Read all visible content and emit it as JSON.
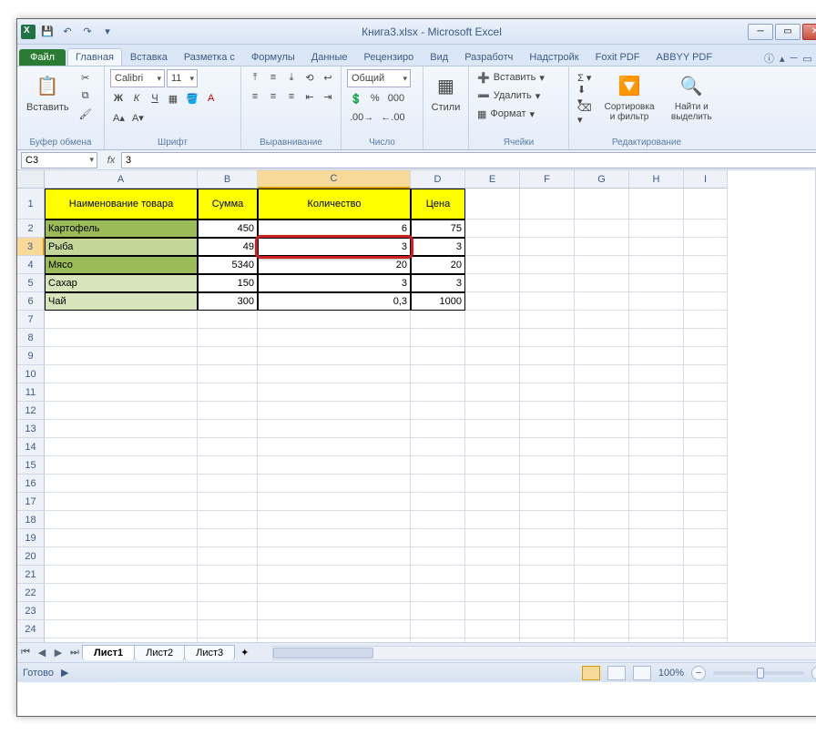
{
  "title": "Книга3.xlsx - Microsoft Excel",
  "qat": {
    "save": "💾",
    "undo": "↶",
    "redo": "↷"
  },
  "tabs": {
    "file": "Файл",
    "items": [
      "Главная",
      "Вставка",
      "Разметка с",
      "Формулы",
      "Данные",
      "Рецензиро",
      "Вид",
      "Разработч",
      "Надстройк",
      "Foxit PDF",
      "ABBYY PDF"
    ],
    "active": 0
  },
  "ribbon": {
    "clipboard": {
      "paste": "Вставить",
      "label": "Буфер обмена"
    },
    "font": {
      "name": "Calibri",
      "size": "11",
      "bold": "Ж",
      "italic": "К",
      "underline": "Ч",
      "label": "Шрифт"
    },
    "align": {
      "label": "Выравнивание"
    },
    "number": {
      "format": "Общий",
      "label": "Число"
    },
    "styles": {
      "btn": "Стили"
    },
    "cells": {
      "insert": "Вставить",
      "delete": "Удалить",
      "format": "Формат",
      "label": "Ячейки"
    },
    "editing": {
      "sort": "Сортировка и фильтр",
      "find": "Найти и выделить",
      "label": "Редактирование"
    }
  },
  "namebox": "C3",
  "formula": "3",
  "columns": [
    {
      "l": "A",
      "w": 168
    },
    {
      "l": "B",
      "w": 66
    },
    {
      "l": "C",
      "w": 168
    },
    {
      "l": "D",
      "w": 60
    },
    {
      "l": "E",
      "w": 60
    },
    {
      "l": "F",
      "w": 60
    },
    {
      "l": "G",
      "w": 60
    },
    {
      "l": "H",
      "w": 60
    },
    {
      "l": "I",
      "w": 48
    }
  ],
  "header_row_h": 34,
  "headers": [
    "Наименование товара",
    "Сумма",
    "Количество",
    "Цена"
  ],
  "rows": [
    {
      "a": "Картофель",
      "b": "450",
      "c": "6",
      "d": "75",
      "cls": "green1"
    },
    {
      "a": "Рыба",
      "b": "49",
      "c": "3",
      "d": "3",
      "cls": "green2"
    },
    {
      "a": "Мясо",
      "b": "5340",
      "c": "20",
      "d": "20",
      "cls": "green1"
    },
    {
      "a": "Сахар",
      "b": "150",
      "c": "3",
      "d": "3",
      "cls": "green3"
    },
    {
      "a": "Чай",
      "b": "300",
      "c": "0,3",
      "d": "1000",
      "cls": "green3"
    }
  ],
  "active_cell": {
    "row": 3,
    "col": "C"
  },
  "sheets": {
    "items": [
      "Лист1",
      "Лист2",
      "Лист3"
    ],
    "active": 0
  },
  "status": {
    "ready": "Готово",
    "zoom": "100%"
  }
}
